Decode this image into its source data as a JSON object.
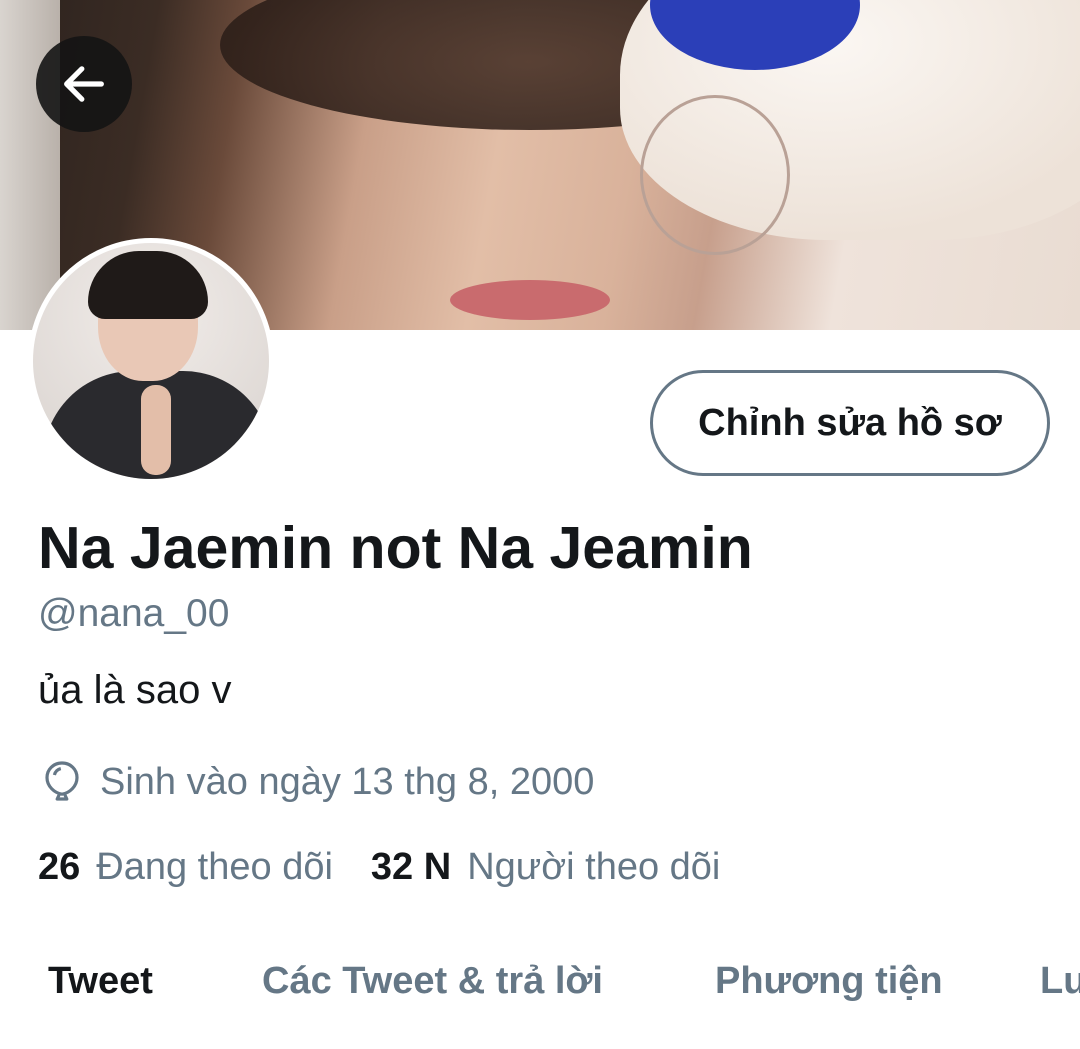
{
  "header": {
    "back_icon": "arrow-left-icon"
  },
  "profile": {
    "edit_button": "Chỉnh sửa hồ sơ",
    "display_name": "Na Jaemin not Na Jeamin",
    "handle": "@nana_00",
    "bio": "ủa là sao v",
    "birth_icon": "balloon-icon",
    "birth_text": "Sinh vào ngày 13 thg 8, 2000",
    "following_count": "26",
    "following_label": "Đang theo dõi",
    "followers_count": "32 N",
    "followers_label": "Người theo dõi"
  },
  "tabs": [
    {
      "label": "Tweet",
      "active": true
    },
    {
      "label": "Các Tweet & trả lời",
      "active": false
    },
    {
      "label": "Phương tiện",
      "active": false
    },
    {
      "label": "Lu",
      "active": false
    }
  ],
  "colors": {
    "primary_text": "#14171a",
    "secondary_text": "#657786"
  }
}
